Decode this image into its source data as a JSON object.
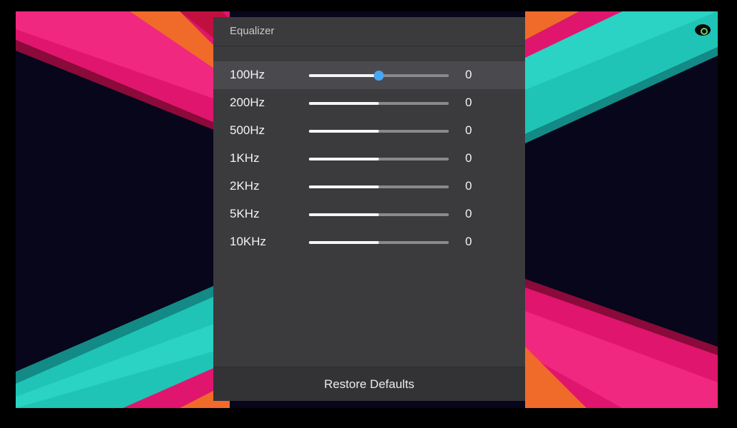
{
  "panel": {
    "title": "Equalizer",
    "restore_label": "Restore Defaults"
  },
  "bands": [
    {
      "label": "100Hz",
      "value": "0",
      "level": 0.5,
      "focused": true
    },
    {
      "label": "200Hz",
      "value": "0",
      "level": 0.5,
      "focused": false
    },
    {
      "label": "500Hz",
      "value": "0",
      "level": 0.5,
      "focused": false
    },
    {
      "label": "1KHz",
      "value": "0",
      "level": 0.5,
      "focused": false
    },
    {
      "label": "2KHz",
      "value": "0",
      "level": 0.5,
      "focused": false
    },
    {
      "label": "5KHz",
      "value": "0",
      "level": 0.5,
      "focused": false
    },
    {
      "label": "10KHz",
      "value": "0",
      "level": 0.5,
      "focused": false
    }
  ],
  "colors": {
    "accent": "#45a7f4",
    "panel": "#3b3b3e",
    "wallpaper_pink": "#e0156e",
    "wallpaper_teal": "#1fc4b6",
    "wallpaper_orange": "#f06a2a"
  },
  "icons": {
    "status": "status-indicator-icon"
  }
}
